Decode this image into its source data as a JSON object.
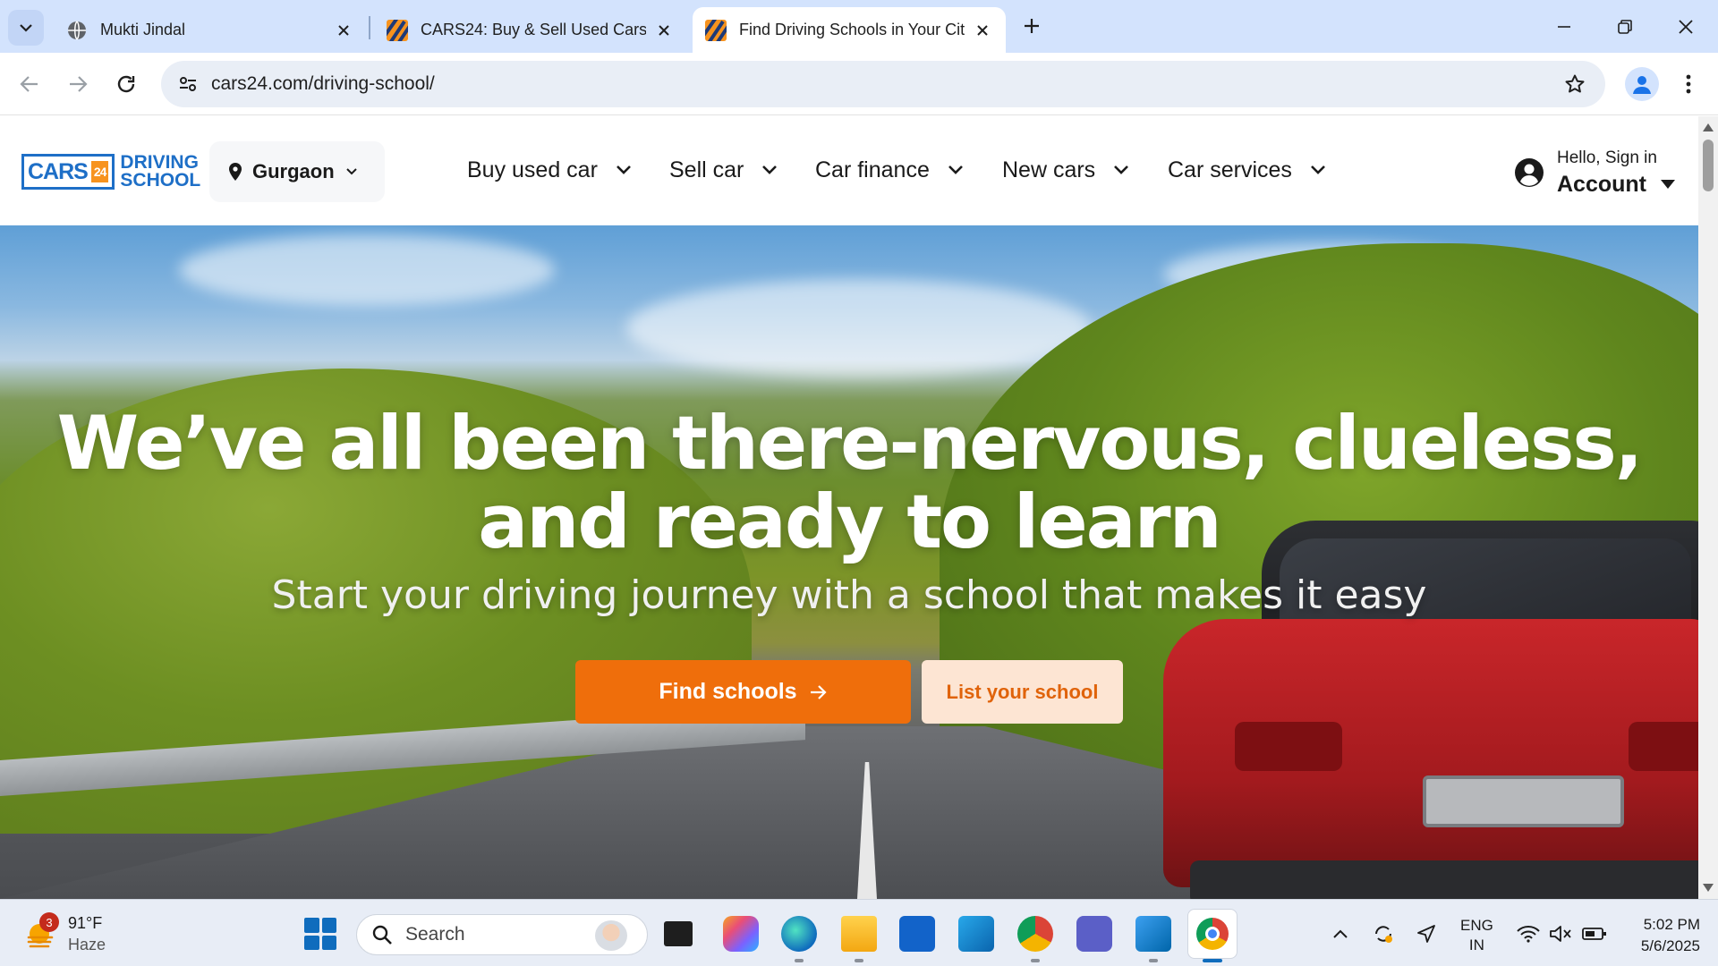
{
  "browser": {
    "tabs": [
      {
        "title": "Mukti Jindal",
        "icon": "globe-icon",
        "active": false
      },
      {
        "title": "CARS24: Buy & Sell Used Cars |",
        "icon": "cars24-icon",
        "active": false
      },
      {
        "title": "Find Driving Schools in Your Cit",
        "icon": "cars24-icon",
        "active": true
      }
    ],
    "url": "cars24.com/driving-school/"
  },
  "site": {
    "logo": {
      "cars": "CARS",
      "num": "24",
      "line1": "DRIVING",
      "line2": "SCHOOL"
    },
    "city": "Gurgaon",
    "nav": [
      {
        "label": "Buy used car"
      },
      {
        "label": "Sell car"
      },
      {
        "label": "Car finance"
      },
      {
        "label": "New cars"
      },
      {
        "label": "Car services"
      }
    ],
    "account": {
      "greeting": "Hello, Sign in",
      "label": "Account"
    },
    "hero": {
      "title_line1": "We’ve all been there-nervous, clueless,",
      "title_line2": "and ready to learn",
      "subtitle": "Start your driving journey with a school that makes it easy",
      "primary_button": "Find schools",
      "secondary_button": "List your school"
    },
    "colors": {
      "brand_blue": "#1e6fc7",
      "cta_orange": "#ef6e0b",
      "cta_light": "#fde5d3"
    }
  },
  "taskbar": {
    "weather": {
      "temp": "91°F",
      "condition": "Haze",
      "badge": "3"
    },
    "search_placeholder": "Search",
    "language": {
      "line1": "ENG",
      "line2": "IN"
    },
    "time": "5:02 PM",
    "date": "5/6/2025"
  }
}
